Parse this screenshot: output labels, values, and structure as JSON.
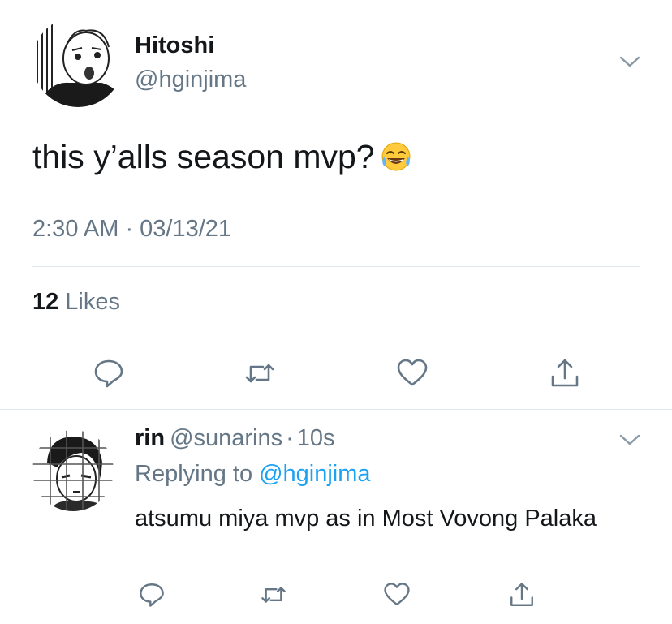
{
  "main_tweet": {
    "display_name": "Hitoshi",
    "handle": "@hginjima",
    "text": "this y’alls season mvp?",
    "emoji": "face-with-tears-of-joy",
    "timestamp": "2:30 AM · 03/13/21",
    "likes_count": "12",
    "likes_label": "Likes"
  },
  "reply": {
    "display_name": "rin",
    "handle": "@sunarins",
    "separator": "·",
    "time": "10s",
    "replying_label": "Replying to",
    "replying_mention": "@hginjima",
    "text": "atsumu miya mvp as in Most Vovong Palaka"
  },
  "icons": {
    "reply": "speech-bubble-icon",
    "retweet": "retweet-icon",
    "like": "heart-icon",
    "share": "share-icon",
    "more": "chevron-down-icon"
  },
  "colors": {
    "text": "#14171a",
    "secondary": "#657786",
    "link": "#1da1f2",
    "divider": "#e1e8ed"
  }
}
